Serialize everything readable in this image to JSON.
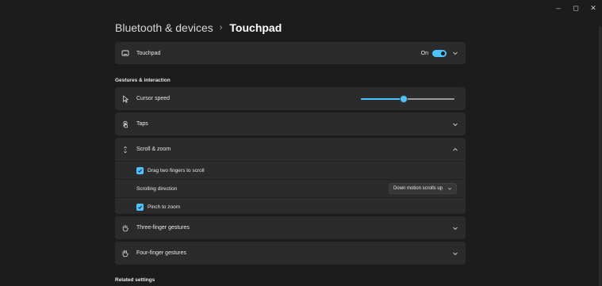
{
  "window_controls": {
    "minimize": "–",
    "maximize": "◻",
    "close": "✕"
  },
  "breadcrumb": {
    "parent": "Bluetooth & devices",
    "separator": "›",
    "current": "Touchpad"
  },
  "touchpad_card": {
    "label": "Touchpad",
    "toggle_state": "On",
    "toggle_on": true
  },
  "gestures_section": {
    "title": "Gestures & interaction"
  },
  "cursor_speed": {
    "label": "Cursor speed",
    "level_percent": 45
  },
  "taps": {
    "label": "Taps"
  },
  "scroll_zoom": {
    "label": "Scroll & zoom",
    "drag_two_fingers": {
      "label": "Drag two fingers to scroll",
      "checked": true
    },
    "scrolling_direction": {
      "label": "Scrolling direction",
      "value": "Down motion scrolls up"
    },
    "pinch_to_zoom": {
      "label": "Pinch to zoom",
      "checked": true
    }
  },
  "three_finger": {
    "label": "Three-finger gestures"
  },
  "four_finger": {
    "label": "Four-finger gestures"
  },
  "related_settings": {
    "title": "Related settings"
  },
  "colors": {
    "accent": "#4cc2ff",
    "background": "#1c1c1c",
    "card": "#2b2b2b"
  }
}
